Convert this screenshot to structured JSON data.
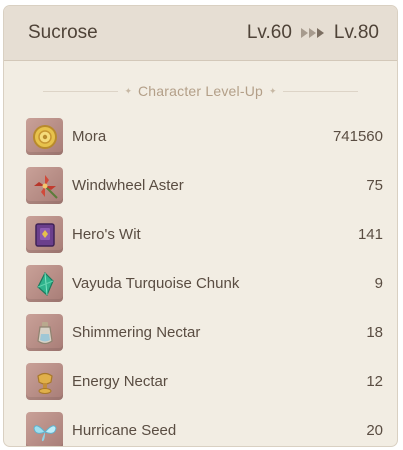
{
  "header": {
    "character": "Sucrose",
    "level_from": "Lv.60",
    "level_to": "Lv.80"
  },
  "section": {
    "title": "Character Level-Up"
  },
  "materials": [
    {
      "name": "Mora",
      "qty": "741560",
      "icon": "mora-coin-icon"
    },
    {
      "name": "Windwheel Aster",
      "qty": "75",
      "icon": "windwheel-aster-icon"
    },
    {
      "name": "Hero's Wit",
      "qty": "141",
      "icon": "heros-wit-book-icon"
    },
    {
      "name": "Vayuda Turquoise Chunk",
      "qty": "9",
      "icon": "turquoise-gem-icon"
    },
    {
      "name": "Shimmering Nectar",
      "qty": "18",
      "icon": "shimmering-nectar-icon"
    },
    {
      "name": "Energy Nectar",
      "qty": "12",
      "icon": "energy-nectar-icon"
    },
    {
      "name": "Hurricane Seed",
      "qty": "20",
      "icon": "hurricane-seed-icon"
    }
  ]
}
